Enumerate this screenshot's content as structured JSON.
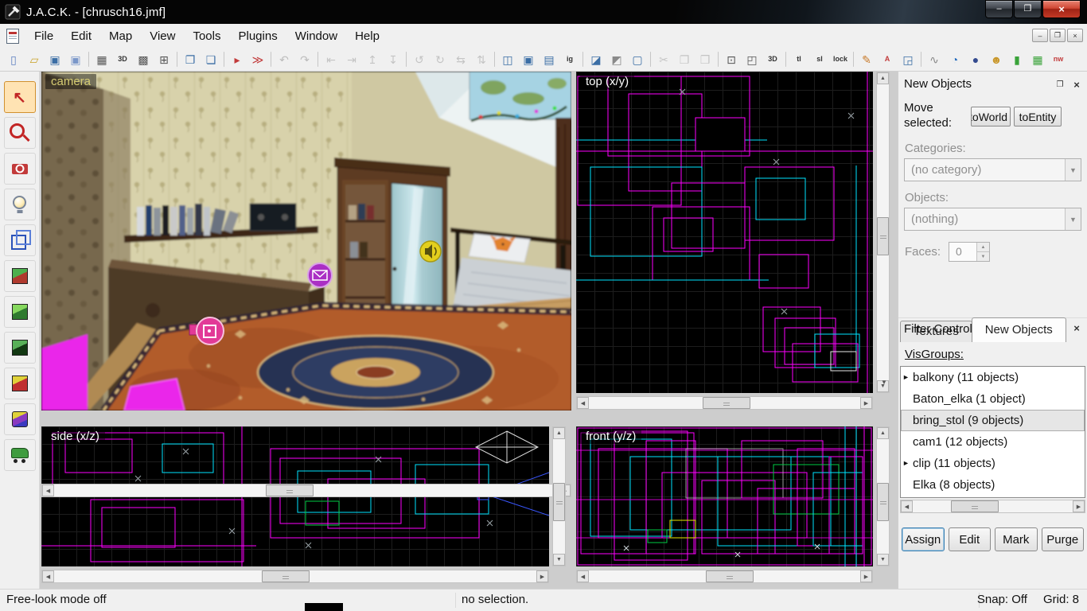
{
  "window": {
    "title": "J.A.C.K. - [chrusch16.jmf]",
    "controls": [
      {
        "name": "minimize-button",
        "glyph": "–",
        "icon": "min"
      },
      {
        "name": "maximize-button",
        "glyph": "❐",
        "icon": "max"
      },
      {
        "name": "close-button",
        "glyph": "×",
        "icon": "close"
      }
    ]
  },
  "menu": {
    "items": [
      {
        "name": "menu-file",
        "label": "File"
      },
      {
        "name": "menu-edit",
        "label": "Edit"
      },
      {
        "name": "menu-map",
        "label": "Map"
      },
      {
        "name": "menu-view",
        "label": "View"
      },
      {
        "name": "menu-tools",
        "label": "Tools"
      },
      {
        "name": "menu-plugins",
        "label": "Plugins"
      },
      {
        "name": "menu-window",
        "label": "Window"
      },
      {
        "name": "menu-help",
        "label": "Help"
      }
    ],
    "window_buttons": [
      {
        "name": "mdi-minimize-button",
        "glyph": "–"
      },
      {
        "name": "mdi-restore-button",
        "glyph": "❐"
      },
      {
        "name": "mdi-close-button",
        "glyph": "×"
      }
    ]
  },
  "toolbar": {
    "items": [
      {
        "name": "new-file-button",
        "glyph": "▯",
        "color": "#5b7ec0"
      },
      {
        "name": "open-file-button",
        "glyph": "▱",
        "color": "#c9a227"
      },
      {
        "name": "save-file-button",
        "glyph": "▣",
        "color": "#3b6ea5"
      },
      {
        "name": "save-all-button",
        "glyph": "▣",
        "color": "#7a97c9"
      },
      {
        "name": "toolbar-separator",
        "sep": true
      },
      {
        "name": "toggle-grid-button",
        "glyph": "▦",
        "color": "#555"
      },
      {
        "name": "toggle-3d-grid-button",
        "glyph": "3D",
        "color": "#333",
        "text": true
      },
      {
        "name": "smaller-grid-button",
        "glyph": "▩",
        "color": "#555"
      },
      {
        "name": "larger-grid-button",
        "glyph": "⊞",
        "color": "#555"
      },
      {
        "name": "toolbar-separator",
        "sep": true
      },
      {
        "name": "cascade-windows-button",
        "glyph": "❐",
        "color": "#3b6ea5"
      },
      {
        "name": "tile-windows-button",
        "glyph": "❏",
        "color": "#3b6ea5"
      },
      {
        "name": "toolbar-separator",
        "sep": true
      },
      {
        "name": "run-map-button",
        "glyph": "▸",
        "color": "#c23b3b"
      },
      {
        "name": "run-map-advanced-button",
        "glyph": "≫",
        "color": "#c23b3b"
      },
      {
        "name": "toolbar-separator",
        "sep": true
      },
      {
        "name": "undo-button",
        "glyph": "↶",
        "color": "#777",
        "disabled": true
      },
      {
        "name": "redo-button",
        "glyph": "↷",
        "color": "#777",
        "disabled": true
      },
      {
        "name": "toolbar-separator",
        "sep": true
      },
      {
        "name": "align-left-button",
        "glyph": "⇤",
        "color": "#888",
        "disabled": true
      },
      {
        "name": "align-right-button",
        "glyph": "⇥",
        "color": "#888",
        "disabled": true
      },
      {
        "name": "align-top-button",
        "glyph": "↥",
        "color": "#888",
        "disabled": true
      },
      {
        "name": "align-bottom-button",
        "glyph": "↧",
        "color": "#888",
        "disabled": true
      },
      {
        "name": "toolbar-separator",
        "sep": true
      },
      {
        "name": "rotate-ccw-button",
        "glyph": "↺",
        "color": "#888",
        "disabled": true
      },
      {
        "name": "rotate-cw-button",
        "glyph": "↻",
        "color": "#888",
        "disabled": true
      },
      {
        "name": "flip-horizontal-button",
        "glyph": "⇆",
        "color": "#888",
        "disabled": true
      },
      {
        "name": "flip-vertical-button",
        "glyph": "⇅",
        "color": "#888",
        "disabled": true
      },
      {
        "name": "toolbar-separator",
        "sep": true
      },
      {
        "name": "carve-button",
        "glyph": "◫",
        "color": "#3b6ea5"
      },
      {
        "name": "group-button",
        "glyph": "▣",
        "color": "#3b6ea5"
      },
      {
        "name": "ungroup-button",
        "glyph": "▤",
        "color": "#3b6ea5"
      },
      {
        "name": "ignore-groups-button",
        "glyph": "ig",
        "color": "#333",
        "text": true
      },
      {
        "name": "toolbar-separator",
        "sep": true
      },
      {
        "name": "hide-selected-button",
        "glyph": "◪",
        "color": "#3b6ea5"
      },
      {
        "name": "hide-unselected-button",
        "glyph": "◩",
        "color": "#8a8a8a"
      },
      {
        "name": "show-all-button",
        "glyph": "▢",
        "color": "#3b6ea5"
      },
      {
        "name": "toolbar-separator",
        "sep": true
      },
      {
        "name": "cut-button",
        "glyph": "✂",
        "color": "#888",
        "disabled": true
      },
      {
        "name": "copy-button",
        "glyph": "❐",
        "color": "#888",
        "disabled": true
      },
      {
        "name": "paste-button",
        "glyph": "❒",
        "color": "#888",
        "disabled": true
      },
      {
        "name": "toolbar-separator",
        "sep": true
      },
      {
        "name": "cordon-button",
        "glyph": "⊡",
        "color": "#555"
      },
      {
        "name": "select-touching-button",
        "glyph": "◰",
        "color": "#555"
      },
      {
        "name": "select-3d-button",
        "glyph": "3D",
        "color": "#333",
        "text": true
      },
      {
        "name": "toolbar-separator",
        "sep": true
      },
      {
        "name": "texture-lock-button",
        "glyph": "tl",
        "color": "#333",
        "text": true
      },
      {
        "name": "sprite-lock-button",
        "glyph": "sl",
        "color": "#333",
        "text": true
      },
      {
        "name": "uv-lock-button",
        "glyph": "lock",
        "color": "#333",
        "text": true
      },
      {
        "name": "toolbar-separator",
        "sep": true
      },
      {
        "name": "path-edit-button",
        "glyph": "✎",
        "color": "#c87a2a"
      },
      {
        "name": "apply-texture-button",
        "glyph": "A",
        "color": "#c23b3b",
        "text": true
      },
      {
        "name": "apply-decal-button",
        "glyph": "◲",
        "color": "#3b6ea5"
      },
      {
        "name": "toolbar-separator",
        "sep": true
      },
      {
        "name": "pointfile-button",
        "glyph": "∿",
        "color": "#888"
      },
      {
        "name": "compass-button",
        "glyph": "◔",
        "color": "#2a6fbf"
      },
      {
        "name": "light-radius-button",
        "glyph": "●",
        "color": "#334a8f"
      },
      {
        "name": "avatar-button",
        "glyph": "☻",
        "color": "#c9972a"
      },
      {
        "name": "model-render-button",
        "glyph": "▮",
        "color": "#3aa33a"
      },
      {
        "name": "grid-settings-button",
        "glyph": "▦",
        "color": "#3aa33a"
      },
      {
        "name": "draw-new-button",
        "glyph": "nw",
        "color": "#c23b3b",
        "text": true
      }
    ]
  },
  "tools": {
    "items": [
      {
        "name": "select-tool",
        "icon": "select",
        "active": true
      },
      {
        "name": "zoom-tool",
        "icon": "zoom"
      },
      {
        "name": "camera-tool",
        "icon": "camera"
      },
      {
        "name": "entity-tool",
        "icon": "entity"
      },
      {
        "name": "brush-tool",
        "icon": "brush"
      },
      {
        "name": "texture-apply-tool",
        "icon": "texcube"
      },
      {
        "name": "decal-tool",
        "icon": "greencube"
      },
      {
        "name": "clip-tool",
        "icon": "darkcube"
      },
      {
        "name": "vertex-tool",
        "icon": "redcube"
      },
      {
        "name": "displacement-tool",
        "icon": "purple"
      },
      {
        "name": "cordon-tool",
        "icon": "car"
      }
    ]
  },
  "viewports": {
    "camera": {
      "label": "camera"
    },
    "top": {
      "label": "top (x/y)"
    },
    "side": {
      "label": "side (x/z)"
    },
    "front": {
      "label": "front (y/z)"
    }
  },
  "panel": {
    "new_objects": {
      "title": "New Objects",
      "move_label": "Move selected:",
      "to_world": "toWorld",
      "to_entity": "toEntity",
      "categories_label": "Categories:",
      "category_value": "(no category)",
      "objects_label": "Objects:",
      "objects_value": "(nothing)",
      "faces_label": "Faces:",
      "faces_value": "0"
    },
    "tabs": [
      {
        "name": "tab-textures",
        "label": "Textures"
      },
      {
        "name": "tab-new-objects",
        "label": "New Objects",
        "active": true
      }
    ],
    "filter": {
      "title": "Filter Control",
      "visgroups_label": "VisGroups:",
      "groups": [
        {
          "name": "visgroup-balkony",
          "label": "balkony (11 objects)",
          "flag": true
        },
        {
          "name": "visgroup-baton-elka",
          "label": "Baton_elka (1 object)"
        },
        {
          "name": "visgroup-bring-stol",
          "label": "bring_stol (9 objects)",
          "selected": true
        },
        {
          "name": "visgroup-cam1",
          "label": "cam1 (12 objects)"
        },
        {
          "name": "visgroup-clip",
          "label": "clip (11 objects)",
          "flag": true
        },
        {
          "name": "visgroup-elka",
          "label": "Elka (8 objects)"
        }
      ],
      "buttons": [
        {
          "name": "assign-button",
          "label": "Assign",
          "active": true
        },
        {
          "name": "edit-button",
          "label": "Edit"
        },
        {
          "name": "mark-button",
          "label": "Mark"
        },
        {
          "name": "purge-button",
          "label": "Purge"
        }
      ]
    }
  },
  "statusbar": {
    "left": "Free-look mode off",
    "middle": "no selection.",
    "snap": "Snap: Off",
    "grid": "Grid: 8"
  },
  "colors": {
    "wire_magenta": "#ff00ff",
    "wire_cyan": "#00e5ff",
    "viewport_background": "#000000",
    "camera_label": "#d6cc72",
    "close_button_red": "#c3362a"
  }
}
